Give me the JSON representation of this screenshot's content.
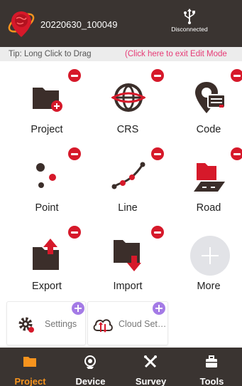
{
  "header": {
    "project_name": "20220630_100049",
    "connection_status": "Disconnected",
    "logo_icon": "globe-location-logo",
    "connection_icon": "usb-icon"
  },
  "tipbar": {
    "tip": "Tip: Long Click to Drag",
    "exit": "(Click here to exit Edit Mode"
  },
  "grid": {
    "items": [
      {
        "label": "Project",
        "icon": "project-folder-icon"
      },
      {
        "label": "CRS",
        "icon": "crs-globe-icon"
      },
      {
        "label": "Code",
        "icon": "code-map-pin-icon"
      },
      {
        "label": "Point",
        "icon": "point-icon"
      },
      {
        "label": "Line",
        "icon": "line-icon"
      },
      {
        "label": "Road",
        "icon": "road-icon"
      },
      {
        "label": "Export",
        "icon": "export-icon"
      },
      {
        "label": "Import",
        "icon": "import-icon"
      },
      {
        "label": "More",
        "icon": "plus-icon"
      }
    ]
  },
  "extras": {
    "items": [
      {
        "label": "Settings",
        "icon": "settings-gear-icon"
      },
      {
        "label": "Cloud Set…",
        "icon": "cloud-settings-icon"
      }
    ]
  },
  "tabs": {
    "items": [
      {
        "label": "Project",
        "icon": "folder-icon",
        "active": true
      },
      {
        "label": "Device",
        "icon": "device-icon",
        "active": false
      },
      {
        "label": "Survey",
        "icon": "survey-icon",
        "active": false
      },
      {
        "label": "Tools",
        "icon": "toolbox-icon",
        "active": false
      }
    ]
  },
  "colors": {
    "bar_background": "#3a3431",
    "accent_red": "#d6192a",
    "active_tab": "#f7941e",
    "tip_link": "#e63a75",
    "add_badge": "#a47be6"
  }
}
